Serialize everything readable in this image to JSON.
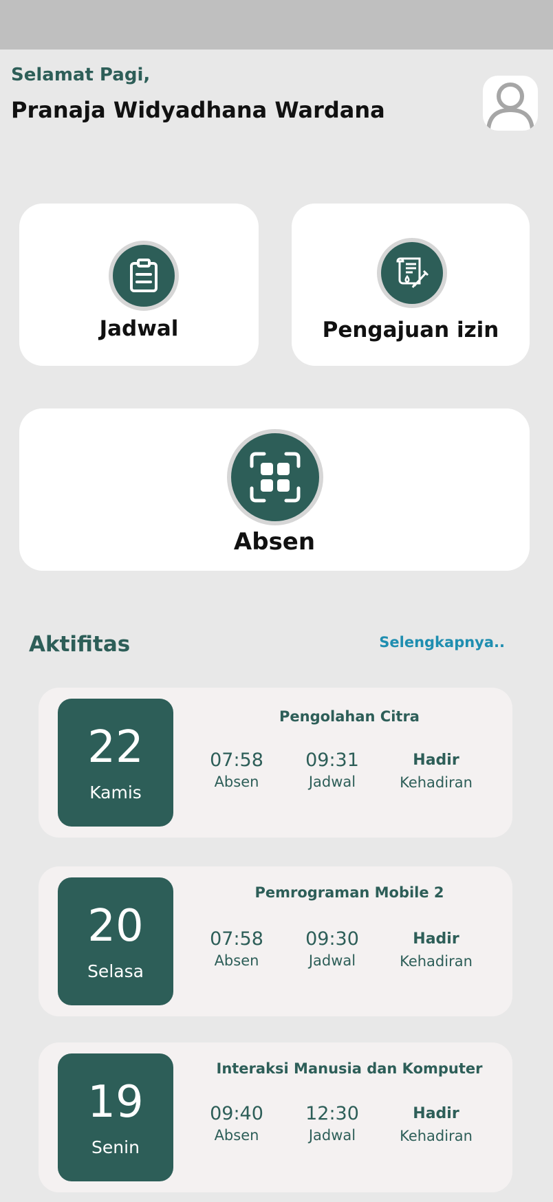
{
  "header": {
    "greeting": "Selamat Pagi,",
    "user_name": "Pranaja Widyadhana Wardana",
    "avatar_icon": "user-avatar-icon"
  },
  "menu": {
    "jadwal_label": "Jadwal",
    "izin_label": "Pengajuan izin",
    "absen_label": "Absen"
  },
  "activity": {
    "title": "Aktifitas",
    "see_more": "Selengkapnya..",
    "items": [
      {
        "date": "22",
        "day": "Kamis",
        "course": "Pengolahan Citra",
        "absen_time": "07:58",
        "absen_label": "Absen",
        "jadwal_time": "09:31",
        "jadwal_label": "Jadwal",
        "status": "Hadir",
        "status_label": "Kehadiran"
      },
      {
        "date": "20",
        "day": "Selasa",
        "course": "Pemrograman Mobile 2",
        "absen_time": "07:58",
        "absen_label": "Absen",
        "jadwal_time": "09:30",
        "jadwal_label": "Jadwal",
        "status": "Hadir",
        "status_label": "Kehadiran"
      },
      {
        "date": "19",
        "day": "Senin",
        "course": "Interaksi Manusia dan Komputer",
        "absen_time": "09:40",
        "absen_label": "Absen",
        "jadwal_time": "12:30",
        "jadwal_label": "Jadwal",
        "status": "Hadir",
        "status_label": "Kehadiran"
      }
    ]
  },
  "colors": {
    "primary": "#2d5e58",
    "link": "#1f8eb0",
    "background": "#e8e8e8"
  }
}
